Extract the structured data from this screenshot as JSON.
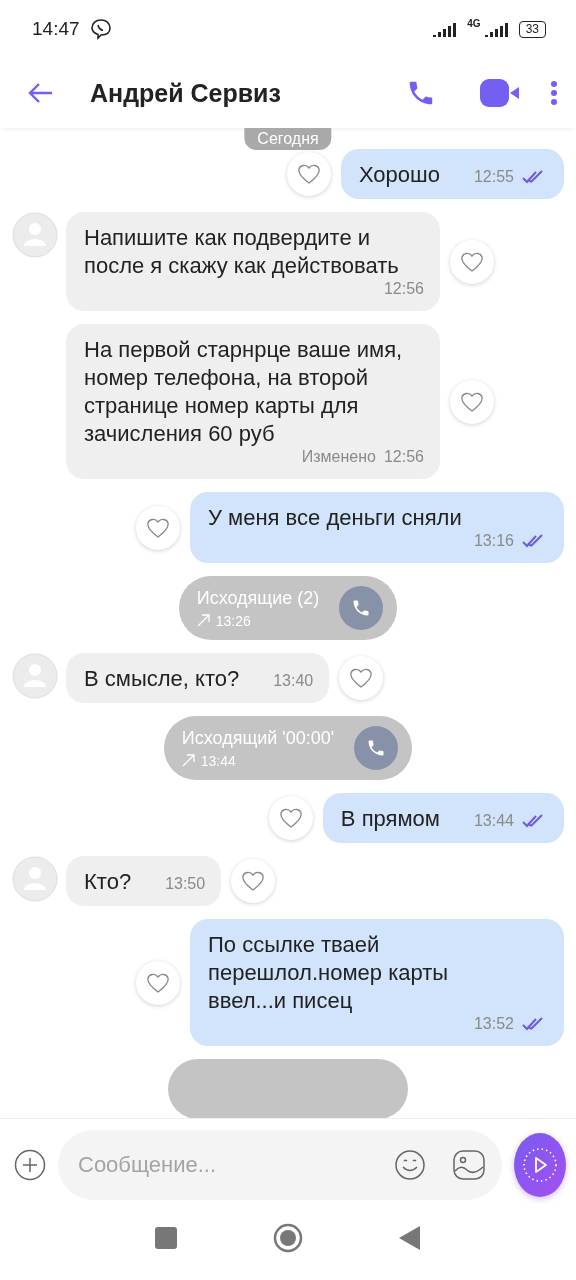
{
  "status_bar": {
    "time": "14:47",
    "network": "4G",
    "battery": "33"
  },
  "header": {
    "title": "Андрей Сервиз"
  },
  "date_label": "Сегодня",
  "messages": [
    {
      "kind": "out",
      "text": "Хорошо",
      "time": "12:55",
      "read": true
    },
    {
      "kind": "in",
      "avatar": true,
      "text": "Напишите как подвердите и после я скажу как действовать",
      "time": "12:56"
    },
    {
      "kind": "in",
      "avatar": false,
      "text": "На первой старнрце ваше имя, номер телефона, на второй странице номер карты для зачисления 60 руб",
      "edited": "Изменено",
      "time": "12:56"
    },
    {
      "kind": "out",
      "text": "У меня все деньги сняли",
      "time": "13:16",
      "read": true
    },
    {
      "kind": "call",
      "text": "Исходящие (2)",
      "time": "13:26"
    },
    {
      "kind": "in",
      "avatar": true,
      "text": "В смысле, кто?",
      "time": "13:40"
    },
    {
      "kind": "call",
      "text": "Исходящий '00:00'",
      "time": "13:44"
    },
    {
      "kind": "out",
      "text": "В прямом",
      "time": "13:44",
      "read": true
    },
    {
      "kind": "in",
      "avatar": true,
      "text": "Кто?",
      "time": "13:50"
    },
    {
      "kind": "out",
      "text": "По ссылке тваей перешлол.номер карты ввел...и писец",
      "time": "13:52",
      "read": true
    },
    {
      "kind": "call_partial"
    }
  ],
  "composer": {
    "placeholder": "Сообщение..."
  }
}
